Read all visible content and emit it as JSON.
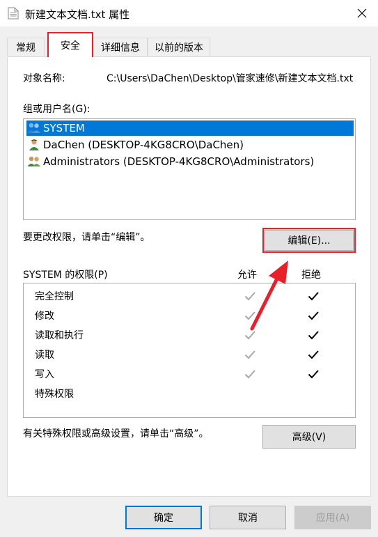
{
  "window": {
    "title": "新建文本文档.txt 属性"
  },
  "tabs": [
    {
      "label": "常规",
      "active": false
    },
    {
      "label": "安全",
      "active": true
    },
    {
      "label": "详细信息",
      "active": false
    },
    {
      "label": "以前的版本",
      "active": false
    }
  ],
  "security": {
    "object_name_label": "对象名称:",
    "object_name_value": "C:\\Users\\DaChen\\Desktop\\管家速修\\新建文本文档.txt",
    "groups_label": "组或用户名(G):",
    "users": [
      {
        "name": "SYSTEM",
        "selected": true,
        "icon": "group-users-icon"
      },
      {
        "name": "DaChen (DESKTOP-4KG8CRO\\DaChen)",
        "selected": false,
        "icon": "user-icon"
      },
      {
        "name": "Administrators (DESKTOP-4KG8CRO\\Administrators)",
        "selected": false,
        "icon": "group-users-icon"
      }
    ],
    "change_hint": "要更改权限，请单击“编辑”。",
    "edit_button": "编辑(E)...",
    "perm_header": "SYSTEM 的权限(P)",
    "allow_header": "允许",
    "deny_header": "拒绝",
    "permissions": [
      {
        "name": "完全控制",
        "allow": "inherited",
        "deny": "checked"
      },
      {
        "name": "修改",
        "allow": "inherited",
        "deny": "checked"
      },
      {
        "name": "读取和执行",
        "allow": "inherited",
        "deny": "checked"
      },
      {
        "name": "读取",
        "allow": "inherited",
        "deny": "checked"
      },
      {
        "name": "写入",
        "allow": "inherited",
        "deny": "checked"
      },
      {
        "name": "特殊权限",
        "allow": "none",
        "deny": "none"
      }
    ],
    "advanced_hint": "有关特殊权限或高级设置，请单击“高级”。",
    "advanced_button": "高级(V)"
  },
  "footer": {
    "ok_button": "确定",
    "cancel_button": "取消",
    "apply_button": "应用(A)"
  },
  "colors": {
    "highlight_red": "#e8202a",
    "selection_blue": "#0078d7",
    "inherited_check": "#a8a8a8"
  }
}
